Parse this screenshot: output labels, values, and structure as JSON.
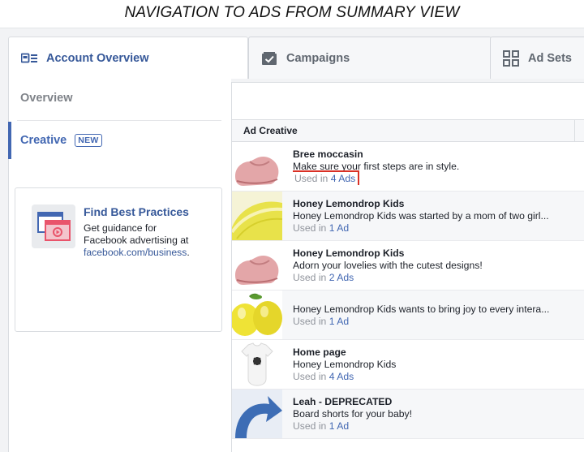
{
  "caption": "NAVIGATION TO ADS FROM SUMMARY VIEW",
  "tabs": [
    {
      "label": "Account Overview",
      "icon": "account-overview-icon"
    },
    {
      "label": "Campaigns",
      "icon": "campaigns-check-icon"
    },
    {
      "label": "Ad Sets",
      "icon": "ad-sets-grid-icon"
    }
  ],
  "sidebar": {
    "overview_label": "Overview",
    "creative_label": "Creative",
    "creative_badge": "NEW"
  },
  "tip": {
    "title": "Find Best Practices",
    "body_line1": "Get guidance for",
    "body_line2": "Facebook advertising at",
    "link": "facebook.com/business",
    "link_suffix": "."
  },
  "table": {
    "header": "Ad Creative",
    "used_prefix": "Used in",
    "rows": [
      {
        "name": "Bree moccasin",
        "desc": "Make sure your first steps are in style.",
        "used_count": "4 Ads",
        "thumb": "pink-shoe"
      },
      {
        "name": "Honey Lemondrop Kids",
        "desc": "Honey Lemondrop Kids was started by a mom of two girl...",
        "used_count": "1 Ad",
        "thumb": "lemon-slice"
      },
      {
        "name": "Honey Lemondrop Kids",
        "desc": "Adorn your lovelies with the cutest designs!",
        "used_count": "2 Ads",
        "thumb": "pink-shoe"
      },
      {
        "name": "",
        "desc": "Honey Lemondrop Kids wants to bring joy to every intera...",
        "used_count": "1 Ad",
        "thumb": "lemons"
      },
      {
        "name": "Home page",
        "desc": "Honey Lemondrop Kids",
        "used_count": "4 Ads",
        "thumb": "onesie"
      },
      {
        "name": "Leah - DEPRECATED",
        "desc": "Board shorts for your baby!",
        "used_count": "1 Ad",
        "thumb": "blue-arrow"
      }
    ]
  },
  "colors": {
    "accent": "#4267b2",
    "highlight": "#d93025",
    "muted": "#90949c"
  }
}
